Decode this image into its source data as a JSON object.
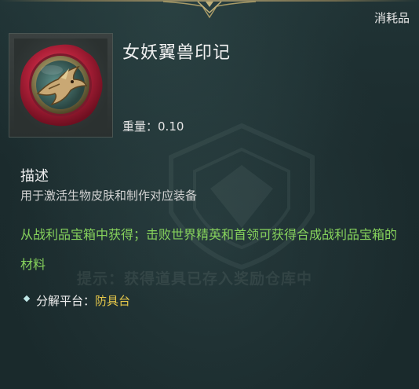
{
  "item": {
    "category": "消耗品",
    "name": "女妖翼兽印记",
    "weight_label": "重量：",
    "weight_value": "0.10",
    "icon_name": "banshee-wyvern-seal-icon"
  },
  "description": {
    "title": "描述",
    "text": "用于激活生物皮肤和制作对应装备",
    "source": "从战利品宝箱中获得；击败世界精英和首领可获得合成战利品宝箱的材料"
  },
  "hint": {
    "text": "提示：获得道具已存入奖励仓库中"
  },
  "crafting": {
    "label": "分解平台：",
    "value": "防具台"
  },
  "colors": {
    "source_text": "#86d25c",
    "platform_value": "#e4c64a",
    "seal_red": "#b3213a",
    "background": "#1c2c2e"
  }
}
